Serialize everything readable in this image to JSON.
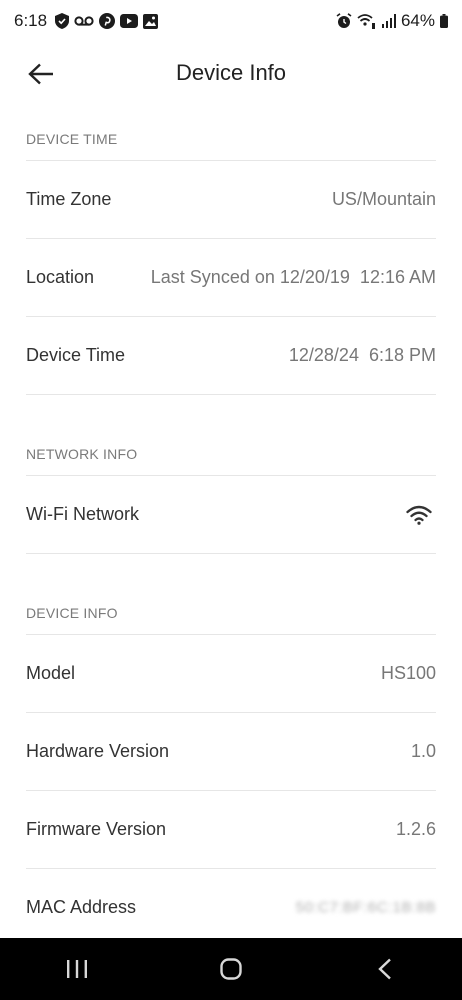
{
  "status_bar": {
    "time": "6:18",
    "battery": "64%",
    "left_icons": [
      "shield-icon",
      "voicemail-icon",
      "pinterest-icon",
      "youtube-icon",
      "gallery-icon"
    ],
    "right_icons": [
      "alarm-icon",
      "wifi-calling-icon",
      "signal-icon",
      "battery-icon"
    ]
  },
  "header": {
    "title": "Device Info"
  },
  "sections": {
    "device_time": {
      "header": "DEVICE TIME",
      "rows": [
        {
          "label": "Time Zone",
          "value": "US/Mountain"
        },
        {
          "label": "Location",
          "value": "Last Synced on 12/20/19  12:16 AM"
        },
        {
          "label": "Device Time",
          "value": "12/28/24  6:18 PM"
        }
      ]
    },
    "network_info": {
      "header": "NETWORK INFO",
      "rows": [
        {
          "label": "Wi-Fi Network",
          "icon": "wifi-icon"
        }
      ]
    },
    "device_info": {
      "header": "DEVICE INFO",
      "rows": [
        {
          "label": "Model",
          "value": "HS100"
        },
        {
          "label": "Hardware Version",
          "value": "1.0"
        },
        {
          "label": "Firmware Version",
          "value": "1.2.6"
        },
        {
          "label": "MAC Address",
          "value": "50:C7:BF:6C:1B:8B"
        }
      ]
    }
  },
  "nav_bar": {
    "buttons": [
      "recent-apps-icon",
      "home-icon",
      "back-icon"
    ]
  },
  "colors": {
    "background": "#ffffff",
    "text_primary": "#333333",
    "text_secondary": "#777777",
    "section_header": "#7a7a7a",
    "divider": "#e6e6e6",
    "nav_bar": "#000000"
  }
}
